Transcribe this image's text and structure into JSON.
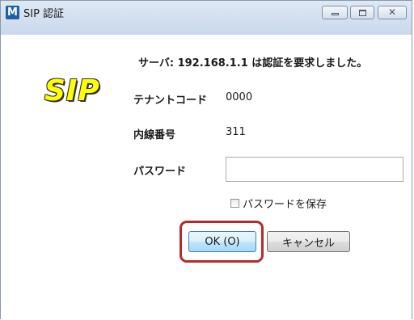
{
  "window": {
    "app_icon_letter": "M",
    "title": "SIP 認証",
    "controls": {
      "minimize": "minimize-icon",
      "maximize": "maximize-icon",
      "close": "close-icon"
    }
  },
  "logo": {
    "text": "SIP",
    "color": "#ffff00"
  },
  "message": "サーバ: 192.168.1.1 は認証を要求しました。",
  "fields": {
    "tenant_label": "テナントコード",
    "tenant_value": "0000",
    "extension_label": "内線番号",
    "extension_value": "311",
    "password_label": "パスワード",
    "password_value": ""
  },
  "save_password": {
    "label": "パスワードを保存",
    "checked": false
  },
  "buttons": {
    "ok": "OK (O)",
    "cancel": "キャンセル"
  },
  "colors": {
    "highlight": "#b52a2a",
    "titlebar": "#c9d8ec",
    "ok_button": "#bee6fd"
  }
}
